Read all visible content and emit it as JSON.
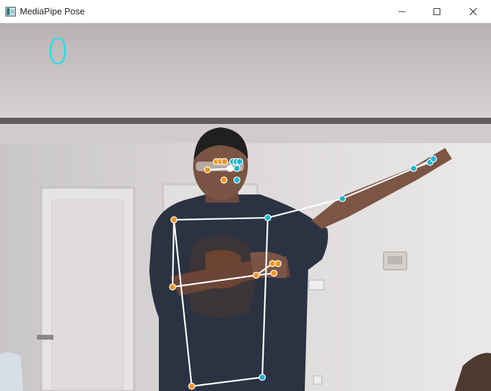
{
  "window": {
    "title": "MediaPipe Pose",
    "minimize_icon": "minimize-icon",
    "maximize_icon": "maximize-icon",
    "close_icon": "close-icon"
  },
  "overlay": {
    "counter": "0",
    "counter_color": "#22ddee"
  },
  "landmarks": {
    "left_color": "#f5941e",
    "right_color": "#1cb6d6",
    "connection_color": "#ffffff"
  }
}
